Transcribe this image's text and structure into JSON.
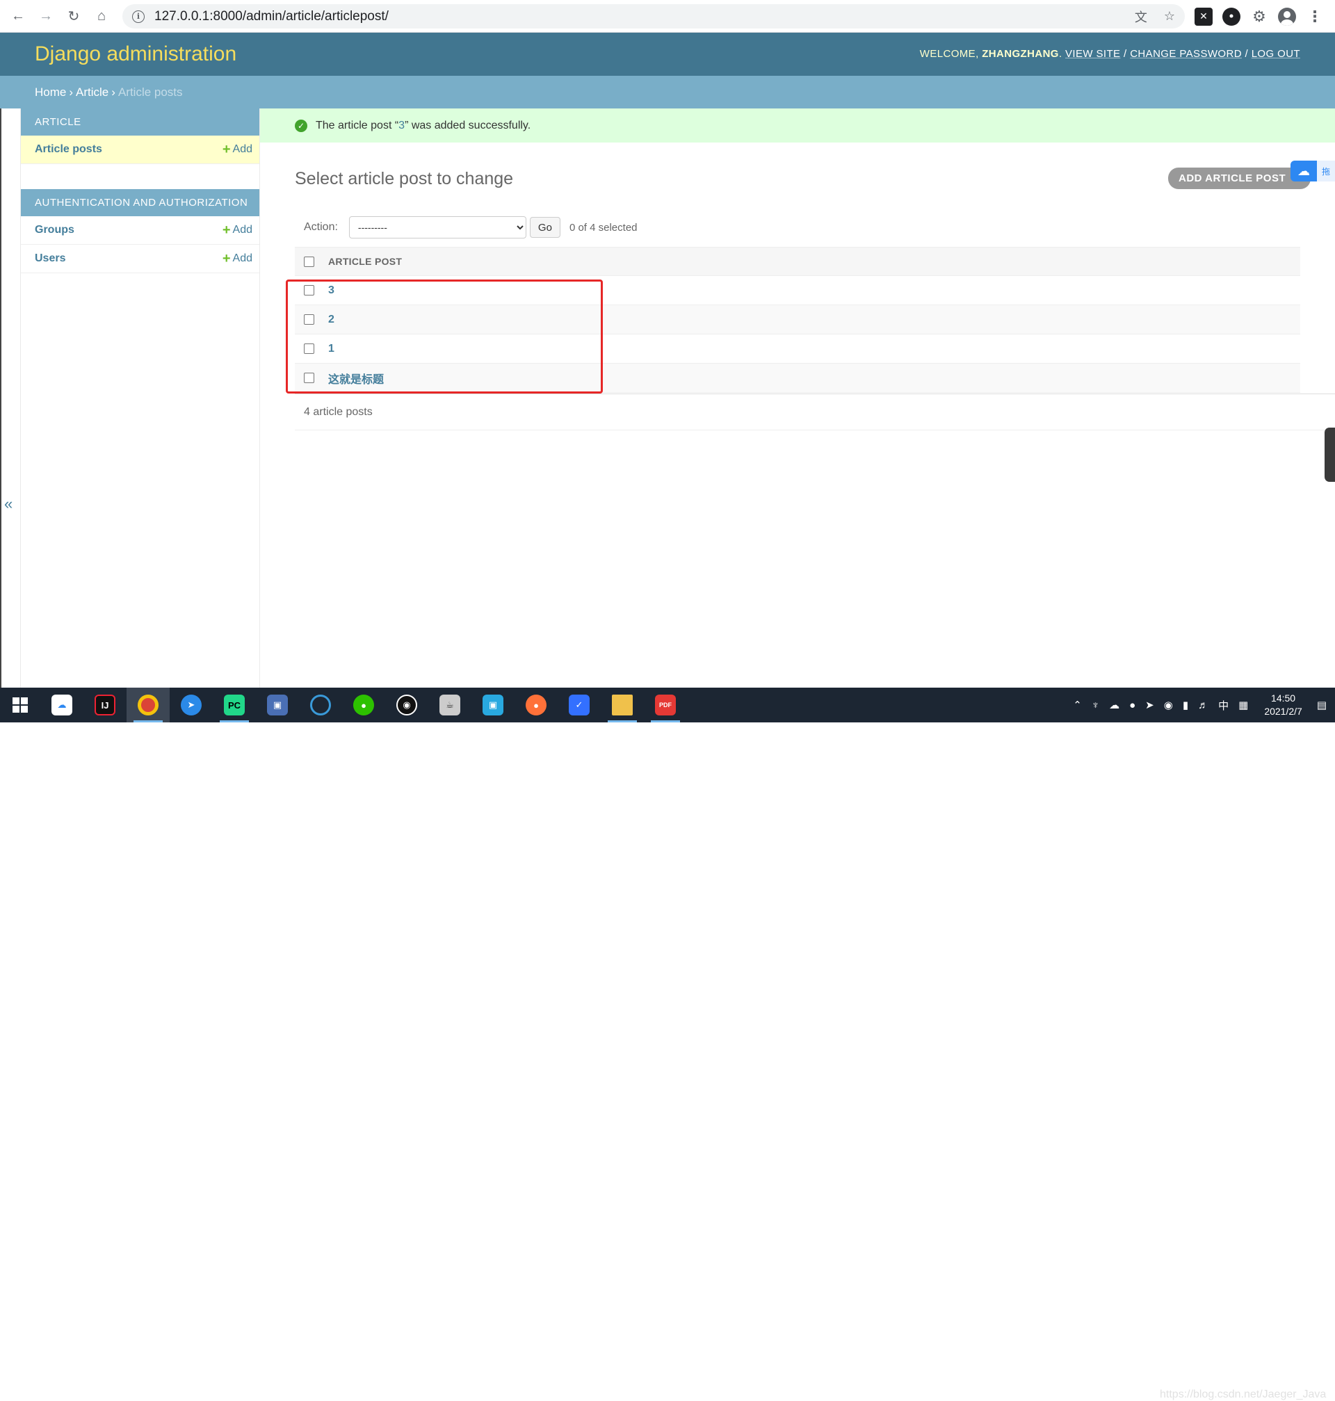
{
  "browser": {
    "url": "127.0.0.1:8000/admin/article/articlepost/"
  },
  "header": {
    "branding": "Django administration",
    "welcome": "WELCOME,",
    "username": "ZHANGZHANG",
    "view_site": "VIEW SITE",
    "change_password": "CHANGE PASSWORD",
    "log_out": "LOG OUT",
    "sep": "/"
  },
  "breadcrumbs": {
    "home": "Home",
    "app": "Article",
    "current": "Article posts",
    "arrow": "›"
  },
  "sidebar": {
    "collapse_label": "«",
    "modules": [
      {
        "caption": "Article",
        "items": [
          {
            "label": "Article posts",
            "add": "Add"
          }
        ]
      },
      {
        "caption": "Authentication and Authorization",
        "items": [
          {
            "label": "Groups",
            "add": "Add"
          },
          {
            "label": "Users",
            "add": "Add"
          }
        ]
      }
    ]
  },
  "message": {
    "prefix": "The article post “",
    "link": "3",
    "suffix": "” was added successfully."
  },
  "main": {
    "title": "Select article post to change",
    "add_button": "ADD ARTICLE POST",
    "add_plus": "+",
    "action_label": "Action:",
    "action_selected": "---------",
    "go": "Go",
    "counter": "0 of 4 selected",
    "column_header": "ARTICLE POST",
    "rows": [
      "3",
      "2",
      "1",
      "这就是标题"
    ],
    "paginator": "4 article posts"
  },
  "float_widget": {
    "tab": "拖"
  },
  "taskbar": {
    "time": "14:50",
    "date": "2021/2/7",
    "ime": "中",
    "watermark": "https://blog.csdn.net/Jaeger_Java"
  },
  "colors": {
    "header": "#417690",
    "breadcrumbs": "#79aec8",
    "branding": "#f5dd5d",
    "link": "#447e9b",
    "success_bg": "#ddffdd",
    "annotation": "#e62727"
  }
}
